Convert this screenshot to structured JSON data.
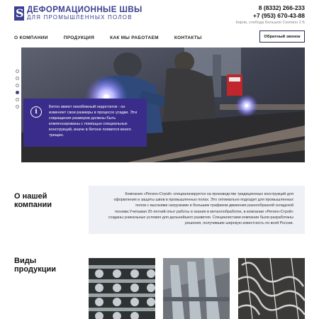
{
  "header": {
    "logo_title": "ДЕФОРМАЦИОННЫЕ ШВЫ",
    "logo_subtitle": "ДЛЯ ПРОМЫШЛЕННЫХ ПОЛОВ",
    "phone_1": "8 (8332) 266-233",
    "phone_2": "+7 (953) 670-43-88",
    "address": "Киров, слобода Большое Скопино 2 Б",
    "callback_label": "Обратный звонок"
  },
  "nav": {
    "items": [
      {
        "label": "О КОМПАНИИ"
      },
      {
        "label": "ПРОДУКЦИЯ"
      },
      {
        "label": "КАК МЫ РАБОТАЕМ"
      },
      {
        "label": "КОНТАКТЫ"
      }
    ]
  },
  "hero": {
    "slide_count": 6,
    "active_slide": 4,
    "info_text": "Бетон имеет неизбежный недостаток - он изменяет свои размеры в процессе усадки. Эти сокращения размеров должны быть компенсированы с помощью специальных конструкций, иначе в бетоне появится много трещин."
  },
  "about": {
    "title": "О нашей компании",
    "text": "Компания «Регион-Строй» специализируется на производстве традиционных конструкций для оформления и защиты швов в промышленных полах. Это оптимально подходит для промышленных полов с высокими нагрузками и большим трафиком движения разнообразной складской техники.Учитывая 20-летний опыт работы и знания в металлобработке, в компании «Регион-Строй» созданы уникальные условия для дальнейшего развития. Специалистами компании были разработаны решения, получившие широкую известность по всей России."
  },
  "products": {
    "title": "Виды продукции"
  },
  "colors": {
    "brand": "#3b3f8f",
    "info_card": "#3a2c8a",
    "about_bg": "#eef0f5"
  }
}
